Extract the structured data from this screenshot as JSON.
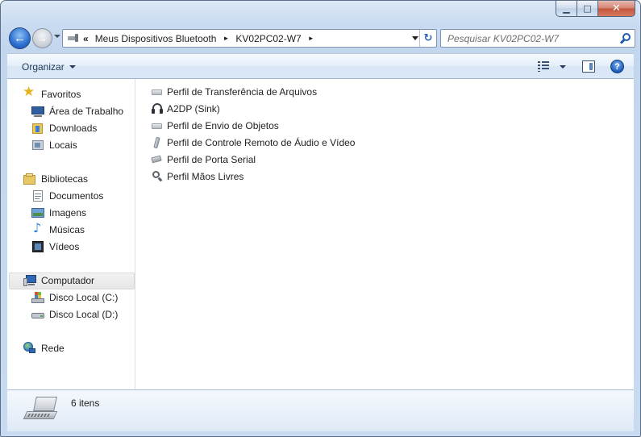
{
  "window": {
    "caption_buttons": {
      "minimize_icon": "minimize-icon",
      "maximize_icon": "maximize-icon",
      "close_icon": "close-icon"
    }
  },
  "navigation": {
    "back_glyph": "←",
    "forward_glyph": "→",
    "address": {
      "overflow_glyph": "«",
      "crumbs": [
        "Meus Dispositivos Bluetooth",
        "KV02PC02-W7"
      ],
      "separator_glyph": "►",
      "refresh_glyph": "↻"
    },
    "search": {
      "placeholder": "Pesquisar KV02PC02-W7"
    }
  },
  "toolbar": {
    "organize_label": "Organizar",
    "help_glyph": "?"
  },
  "sidebar": {
    "groups": [
      {
        "label": "Favoritos",
        "icon": "star-icon",
        "items": [
          {
            "label": "Área de Trabalho",
            "icon": "desktop-icon"
          },
          {
            "label": "Downloads",
            "icon": "downloads-folder-icon"
          },
          {
            "label": "Locais",
            "icon": "recent-places-icon"
          }
        ]
      },
      {
        "label": "Bibliotecas",
        "icon": "libraries-icon",
        "items": [
          {
            "label": "Documentos",
            "icon": "documents-icon"
          },
          {
            "label": "Imagens",
            "icon": "pictures-icon"
          },
          {
            "label": "Músicas",
            "icon": "music-icon"
          },
          {
            "label": "Vídeos",
            "icon": "videos-icon"
          }
        ]
      },
      {
        "label": "Computador",
        "icon": "computer-icon",
        "selected": true,
        "items": [
          {
            "label": "Disco Local (C:)",
            "icon": "system-drive-icon"
          },
          {
            "label": "Disco Local (D:)",
            "icon": "drive-icon"
          }
        ]
      },
      {
        "label": "Rede",
        "icon": "network-icon",
        "items": []
      }
    ]
  },
  "content": {
    "items": [
      {
        "label": "Perfil de Transferência de Arquivos",
        "icon": "file-transfer-profile-icon"
      },
      {
        "label": "A2DP (Sink)",
        "icon": "headphones-icon"
      },
      {
        "label": "Perfil de Envio de Objetos",
        "icon": "object-push-profile-icon"
      },
      {
        "label": "Perfil de Controle Remoto de Áudio e Vídeo",
        "icon": "remote-control-icon"
      },
      {
        "label": "Perfil de Porta Serial",
        "icon": "serial-port-icon"
      },
      {
        "label": "Perfil Mãos Livres",
        "icon": "handsfree-icon"
      }
    ]
  },
  "details": {
    "count_label": "6 itens",
    "icon": "laptop-icon"
  }
}
